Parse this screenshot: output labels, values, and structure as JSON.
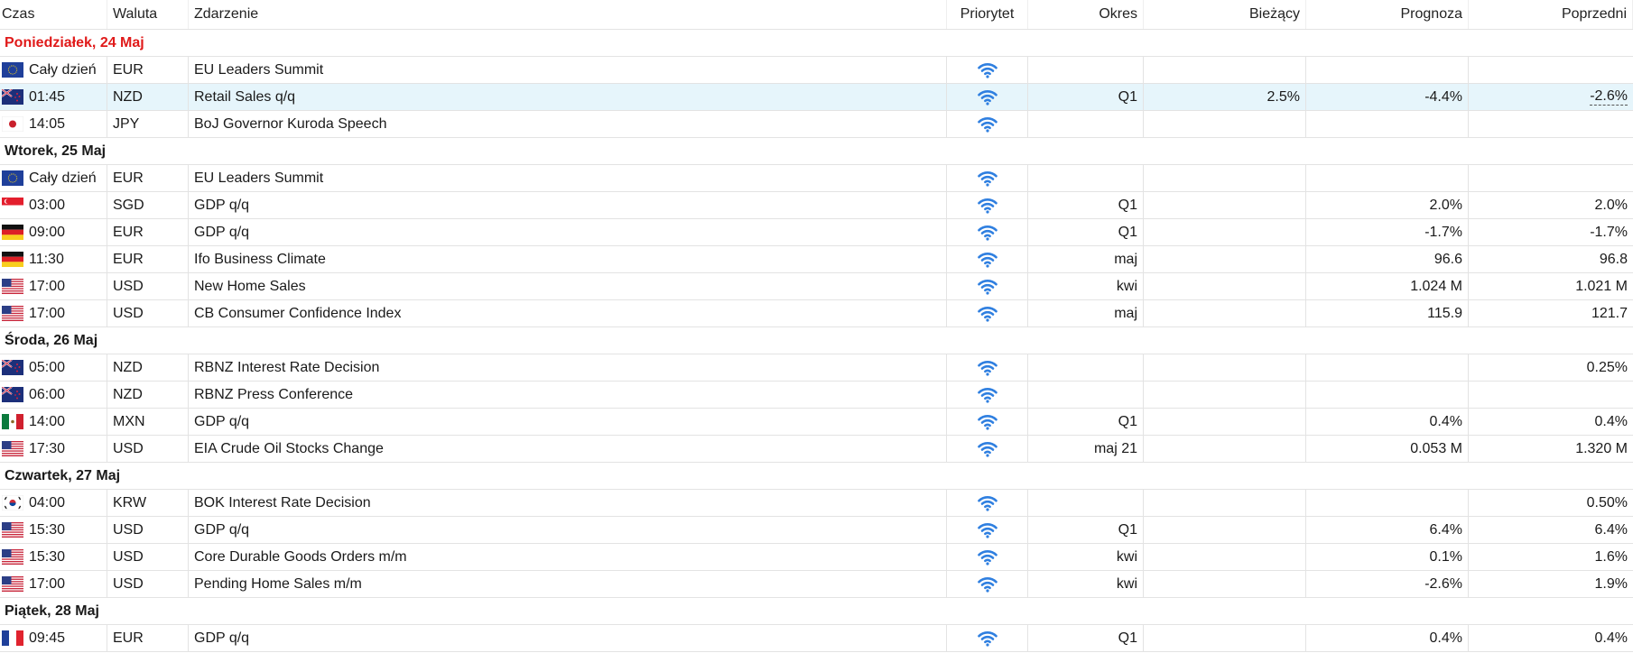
{
  "columns": {
    "time": "Czas",
    "currency": "Waluta",
    "event": "Zdarzenie",
    "priority": "Priorytet",
    "period": "Okres",
    "actual": "Bieżący",
    "forecast": "Prognoza",
    "previous": "Poprzedni"
  },
  "colors": {
    "today": "#e01a1a",
    "selected_row": "#e6f5fb",
    "priority_icon": "#2f7fe0"
  },
  "days": [
    {
      "label": "Poniedziałek, 24 Maj",
      "today": true,
      "events": [
        {
          "flag": "eu-flag-icon",
          "time": "Cały dzień",
          "currency": "EUR",
          "event": "EU Leaders Summit",
          "period": "",
          "actual": "",
          "forecast": "",
          "previous": ""
        },
        {
          "flag": "nz-flag-icon",
          "time": "01:45",
          "currency": "NZD",
          "event": "Retail Sales q/q",
          "period": "Q1",
          "actual": "2.5%",
          "forecast": "-4.4%",
          "previous": "-2.6%",
          "selected": true
        },
        {
          "flag": "jp-flag-icon",
          "time": "14:05",
          "currency": "JPY",
          "event": "BoJ Governor Kuroda Speech",
          "period": "",
          "actual": "",
          "forecast": "",
          "previous": ""
        }
      ]
    },
    {
      "label": "Wtorek, 25 Maj",
      "events": [
        {
          "flag": "eu-flag-icon",
          "time": "Cały dzień",
          "currency": "EUR",
          "event": "EU Leaders Summit",
          "period": "",
          "actual": "",
          "forecast": "",
          "previous": ""
        },
        {
          "flag": "sg-flag-icon",
          "time": "03:00",
          "currency": "SGD",
          "event": "GDP q/q",
          "period": "Q1",
          "actual": "",
          "forecast": "2.0%",
          "previous": "2.0%"
        },
        {
          "flag": "de-flag-icon",
          "time": "09:00",
          "currency": "EUR",
          "event": "GDP q/q",
          "period": "Q1",
          "actual": "",
          "forecast": "-1.7%",
          "previous": "-1.7%"
        },
        {
          "flag": "de-flag-icon",
          "time": "11:30",
          "currency": "EUR",
          "event": "Ifo Business Climate",
          "period": "maj",
          "actual": "",
          "forecast": "96.6",
          "previous": "96.8"
        },
        {
          "flag": "us-flag-icon",
          "time": "17:00",
          "currency": "USD",
          "event": "New Home Sales",
          "period": "kwi",
          "actual": "",
          "forecast": "1.024 M",
          "previous": "1.021 M"
        },
        {
          "flag": "us-flag-icon",
          "time": "17:00",
          "currency": "USD",
          "event": "CB Consumer Confidence Index",
          "period": "maj",
          "actual": "",
          "forecast": "115.9",
          "previous": "121.7"
        }
      ]
    },
    {
      "label": "Środa, 26 Maj",
      "events": [
        {
          "flag": "nz-flag-icon",
          "time": "05:00",
          "currency": "NZD",
          "event": "RBNZ Interest Rate Decision",
          "period": "",
          "actual": "",
          "forecast": "",
          "previous": "0.25%"
        },
        {
          "flag": "nz-flag-icon",
          "time": "06:00",
          "currency": "NZD",
          "event": "RBNZ Press Conference",
          "period": "",
          "actual": "",
          "forecast": "",
          "previous": ""
        },
        {
          "flag": "mx-flag-icon",
          "time": "14:00",
          "currency": "MXN",
          "event": "GDP q/q",
          "period": "Q1",
          "actual": "",
          "forecast": "0.4%",
          "previous": "0.4%"
        },
        {
          "flag": "us-flag-icon",
          "time": "17:30",
          "currency": "USD",
          "event": "EIA Crude Oil Stocks Change",
          "period": "maj 21",
          "actual": "",
          "forecast": "0.053 M",
          "previous": "1.320 M"
        }
      ]
    },
    {
      "label": "Czwartek, 27 Maj",
      "events": [
        {
          "flag": "kr-flag-icon",
          "time": "04:00",
          "currency": "KRW",
          "event": "BOK Interest Rate Decision",
          "period": "",
          "actual": "",
          "forecast": "",
          "previous": "0.50%"
        },
        {
          "flag": "us-flag-icon",
          "time": "15:30",
          "currency": "USD",
          "event": "GDP q/q",
          "period": "Q1",
          "actual": "",
          "forecast": "6.4%",
          "previous": "6.4%"
        },
        {
          "flag": "us-flag-icon",
          "time": "15:30",
          "currency": "USD",
          "event": "Core Durable Goods Orders m/m",
          "period": "kwi",
          "actual": "",
          "forecast": "0.1%",
          "previous": "1.6%"
        },
        {
          "flag": "us-flag-icon",
          "time": "17:00",
          "currency": "USD",
          "event": "Pending Home Sales m/m",
          "period": "kwi",
          "actual": "",
          "forecast": "-2.6%",
          "previous": "1.9%"
        }
      ]
    },
    {
      "label": "Piątek, 28 Maj",
      "events": [
        {
          "flag": "fr-flag-icon",
          "time": "09:45",
          "currency": "EUR",
          "event": "GDP q/q",
          "period": "Q1",
          "actual": "",
          "forecast": "0.4%",
          "previous": "0.4%"
        }
      ]
    }
  ]
}
